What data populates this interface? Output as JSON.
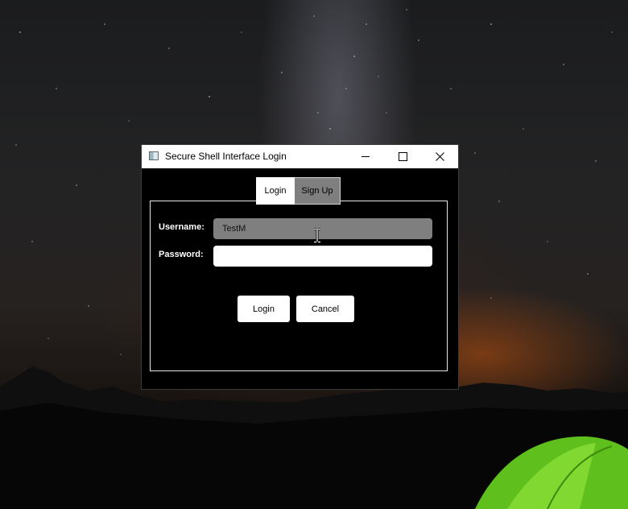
{
  "window": {
    "title": "Secure Shell Interface Login",
    "controls": {
      "minimize": "minimize",
      "maximize": "maximize",
      "close": "close"
    }
  },
  "tabs": [
    {
      "label": "Login",
      "active": true
    },
    {
      "label": "Sign Up",
      "active": false
    }
  ],
  "form": {
    "username_label": "Username:",
    "username_value": "TestM",
    "password_label": "Password:",
    "password_value": ""
  },
  "buttons": {
    "login_label": "Login",
    "cancel_label": "Cancel"
  },
  "colors": {
    "window_bg": "#000000",
    "titlebar_bg": "#ffffff",
    "field_focused_bg": "#7f7f7f",
    "field_bg": "#ffffff",
    "tab_inactive_bg": "#7f7f7f"
  },
  "icons": {
    "app": "app-window-icon",
    "cursor": "text-cursor-icon"
  }
}
